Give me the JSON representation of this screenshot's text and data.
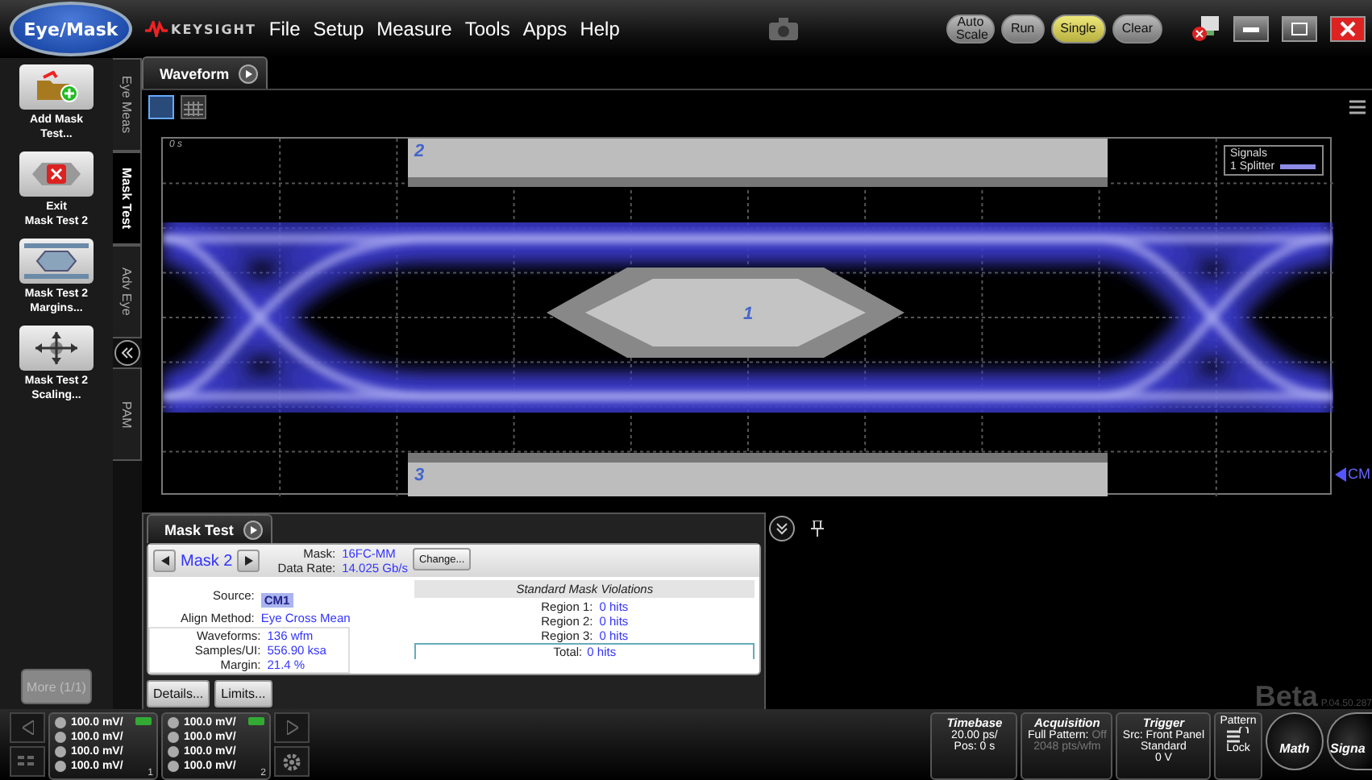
{
  "app_button": "Eye/Mask",
  "brand": "KEYSIGHT",
  "menu": [
    "File",
    "Setup",
    "Measure",
    "Tools",
    "Apps",
    "Help"
  ],
  "run_controls": [
    {
      "label": "Auto Scale",
      "selected": false
    },
    {
      "label": "Run",
      "selected": false
    },
    {
      "label": "Single",
      "selected": true
    },
    {
      "label": "Clear",
      "selected": false
    }
  ],
  "sidebar_actions": [
    {
      "kind": "add",
      "label": "Add Mask\nTest..."
    },
    {
      "kind": "exit",
      "label": "Exit\nMask Test 2"
    },
    {
      "kind": "margins",
      "label": "Mask Test 2\nMargins..."
    },
    {
      "kind": "scaling",
      "label": "Mask Test 2\nScaling..."
    }
  ],
  "more_button": {
    "label": "More (1/1)",
    "disabled": true
  },
  "side_tabs": [
    {
      "kind": "tab",
      "label": "Eye Meas",
      "selected": false
    },
    {
      "kind": "tab",
      "label": "Mask Test",
      "selected": true
    },
    {
      "kind": "tab",
      "label": "Adv Eye",
      "selected": false
    },
    {
      "kind": "collapse"
    },
    {
      "kind": "tab",
      "label": "PAM",
      "selected": false
    }
  ],
  "waveform": {
    "tab": "Waveform",
    "time_origin": "0 s",
    "mask_regions": [
      {
        "kind": "top",
        "label": "2"
      },
      {
        "kind": "center",
        "label": "1"
      },
      {
        "kind": "bottom",
        "label": "3"
      }
    ],
    "signals": {
      "title": "Signals",
      "items": [
        {
          "label": "1 Splitter",
          "color": "#8c8ce8"
        }
      ]
    },
    "channel_marker": "CM"
  },
  "mask_test": {
    "tab": "Mask Test",
    "mask_name": "Mask 2",
    "mask_label": "Mask:",
    "mask_value": "16FC-MM",
    "rate_label": "Data Rate:",
    "rate_value": "14.025 Gb/s",
    "change_button": "Change...",
    "source_label": "Source:",
    "source_value": "CM1",
    "align_label": "Align Method:",
    "align_value": "Eye Cross Mean",
    "stats": [
      {
        "label": "Waveforms:",
        "value": "136 wfm"
      },
      {
        "label": "Samples/UI:",
        "value": "556.90 ksa"
      },
      {
        "label": "Margin:",
        "value": "21.4 %"
      }
    ],
    "violations_title": "Standard Mask Violations",
    "violations": [
      {
        "label": "Region 1:",
        "value": "0 hits"
      },
      {
        "label": "Region 2:",
        "value": "0 hits"
      },
      {
        "label": "Region 3:",
        "value": "0 hits"
      }
    ],
    "total": {
      "label": "Total:",
      "value": "0 hits"
    },
    "buttons": [
      "Details...",
      "Limits..."
    ]
  },
  "version": {
    "beta": "Beta",
    "build": "P.04.50.287"
  },
  "status_bar": {
    "channel_groups": [
      {
        "number": "1",
        "scales": [
          "100.0 mV/",
          "100.0 mV/",
          "100.0 mV/",
          "100.0 mV/"
        ]
      },
      {
        "number": "2",
        "scales": [
          "100.0 mV/",
          "100.0 mV/",
          "100.0 mV/",
          "100.0 mV/"
        ]
      }
    ],
    "timebase": {
      "title": "Timebase",
      "lines": [
        "20.00 ps/",
        "Pos: 0 s"
      ]
    },
    "acquisition": {
      "title": "Acquisition",
      "label": "Full Pattern:",
      "value": "Off",
      "value_disabled": true,
      "detail": "2048 pts/wfm",
      "detail_disabled": true
    },
    "trigger": {
      "title": "Trigger",
      "lines": [
        "Src: Front Panel",
        "Standard",
        "0 V"
      ]
    },
    "pattern": {
      "title": "Pattern",
      "lock": "Lock"
    },
    "round_buttons": [
      "Math",
      "Signa"
    ]
  }
}
